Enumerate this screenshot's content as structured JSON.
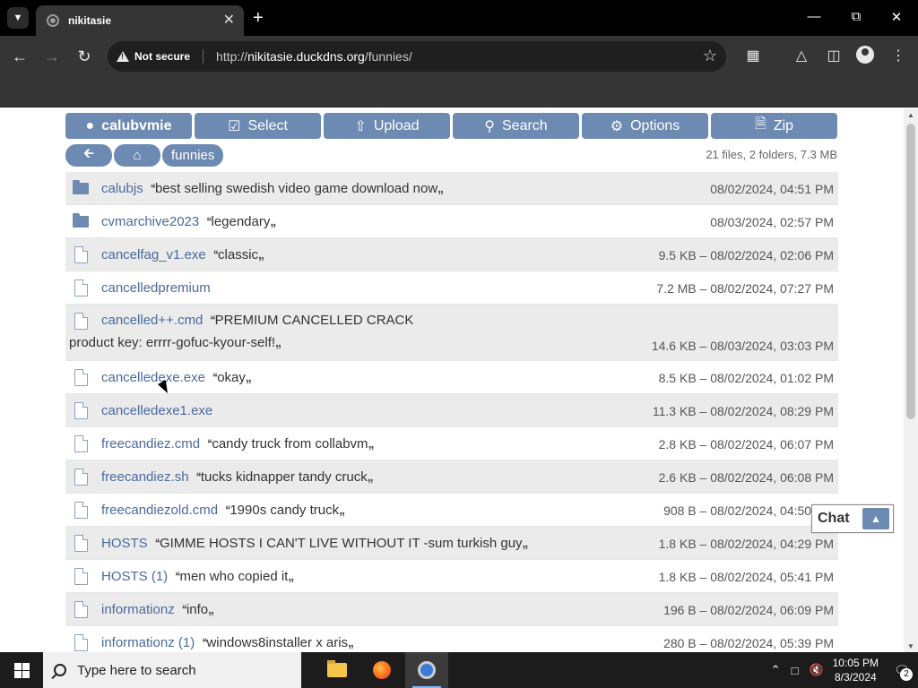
{
  "browser": {
    "tab_title": "nikitasie",
    "security_label": "Not secure",
    "url_scheme": "http://",
    "url_host": "nikitasie.duckdns.org",
    "url_path": "/funnies/"
  },
  "page": {
    "ops": [
      {
        "label": "calubvmie",
        "icon": "user-icon"
      },
      {
        "label": "Select",
        "icon": "checkbox-icon"
      },
      {
        "label": "Upload",
        "icon": "upload-icon"
      },
      {
        "label": "Search",
        "icon": "search-icon"
      },
      {
        "label": "Options",
        "icon": "gear-icon"
      },
      {
        "label": "Zip",
        "icon": "zip-icon"
      }
    ],
    "breadcrumb_current": "funnies",
    "summary": "21 files, 2 folders, 7.3 MB",
    "open_quote": "‘‘",
    "close_quote": ",,",
    "files": [
      {
        "type": "folder",
        "name": "calubjs",
        "desc": "best selling swedish video game download now",
        "meta": "08/02/2024, 04:51 PM"
      },
      {
        "type": "folder",
        "name": "cvmarchive2023",
        "desc": "legendary",
        "meta": "08/03/2024, 02:57 PM"
      },
      {
        "type": "file",
        "name": "cancelfag_v1.exe",
        "desc": "classic",
        "meta": "9.5 KB – 08/02/2024, 02:06 PM"
      },
      {
        "type": "file",
        "name": "cancelledpremium",
        "desc": "",
        "meta": "7.2 MB – 08/02/2024, 07:27 PM"
      },
      {
        "type": "file",
        "name": "cancelled++.cmd",
        "desc": "PREMIUM CANCELLED CRACK",
        "desc2": "product key: errrr-gofuc-kyour-self!",
        "meta": "14.6 KB – 08/03/2024, 03:03 PM"
      },
      {
        "type": "file",
        "name": "cancelledexe.exe",
        "desc": "okay",
        "meta": "8.5 KB – 08/02/2024, 01:02 PM"
      },
      {
        "type": "file",
        "name": "cancelledexe1.exe",
        "desc": "",
        "meta": "11.3 KB – 08/02/2024, 08:29 PM"
      },
      {
        "type": "file",
        "name": "freecandiez.cmd",
        "desc": "candy truck from collabvm",
        "meta": "2.8 KB – 08/02/2024, 06:07 PM"
      },
      {
        "type": "file",
        "name": "freecandiez.sh",
        "desc": "tucks kidnapper tandy cruck",
        "meta": "2.6 KB – 08/02/2024, 06:08 PM"
      },
      {
        "type": "file",
        "name": "freecandiezold.cmd",
        "desc": "1990s candy truck",
        "meta": "908 B – 08/02/2024, 04:50 PM"
      },
      {
        "type": "file",
        "name": "HOSTS",
        "desc": "GIMME HOSTS I CAN'T LIVE WITHOUT IT -sum turkish guy",
        "meta": "1.8 KB – 08/02/2024, 04:29 PM"
      },
      {
        "type": "file",
        "name": "HOSTS (1)",
        "desc": "men who copied it",
        "meta": "1.8 KB – 08/02/2024, 05:41 PM"
      },
      {
        "type": "file",
        "name": "informationz",
        "desc": "info",
        "meta": "196 B – 08/02/2024, 06:09 PM"
      },
      {
        "type": "file",
        "name": "informationz (1)",
        "desc": "windows8installer x aris",
        "meta": "280 B – 08/02/2024, 05:39 PM"
      }
    ],
    "chat_label": "Chat"
  },
  "taskbar": {
    "search_placeholder": "Type here to search",
    "time": "10:05 PM",
    "date": "8/3/2024",
    "notification_count": "2"
  },
  "colors": {
    "accent": "#6d8ab3",
    "link": "#4a6a9c"
  }
}
